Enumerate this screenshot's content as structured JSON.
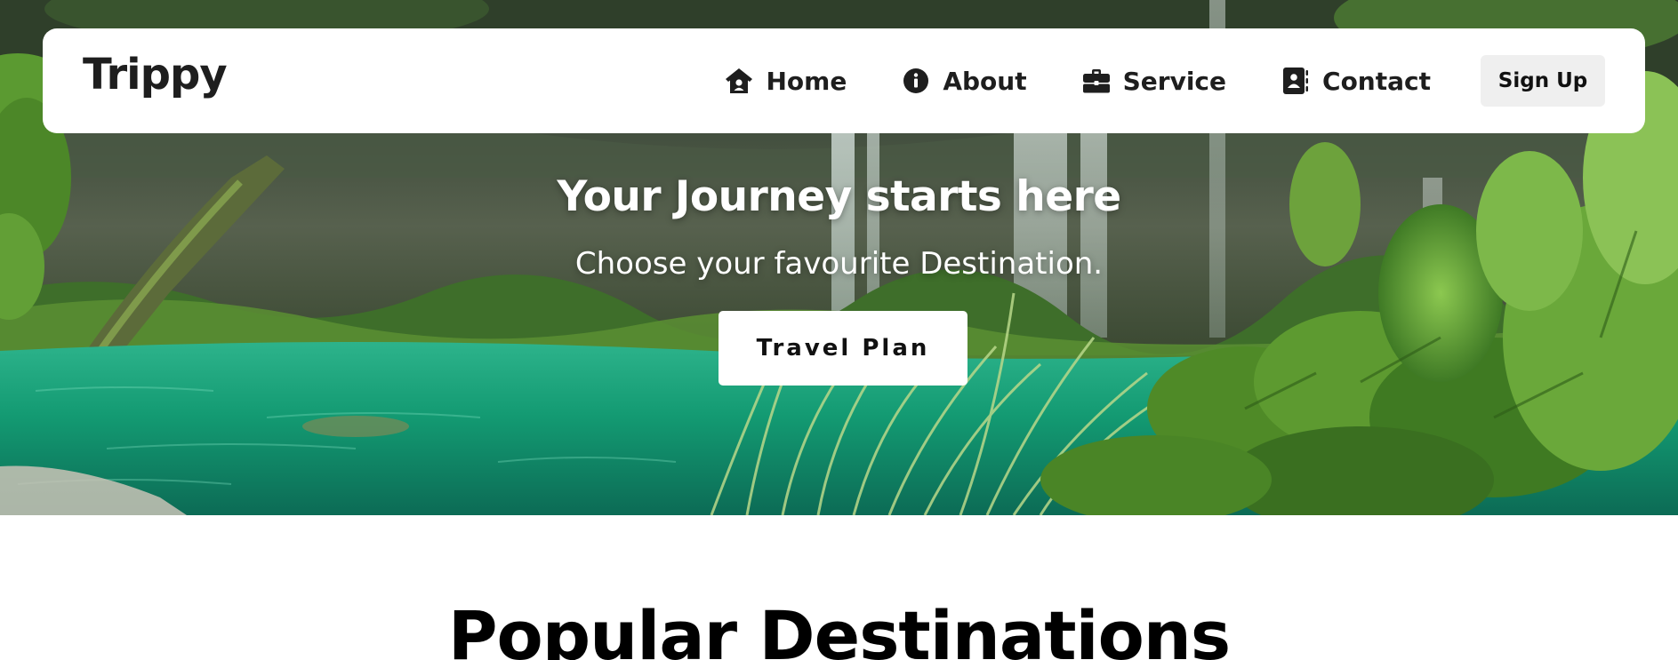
{
  "navbar": {
    "brand": "Trippy",
    "links": [
      {
        "label": "Home",
        "icon": "home-icon"
      },
      {
        "label": "About",
        "icon": "info-icon"
      },
      {
        "label": "Service",
        "icon": "briefcase-icon"
      },
      {
        "label": "Contact",
        "icon": "contact-book-icon"
      }
    ],
    "signup_label": "Sign Up"
  },
  "hero": {
    "title": "Your Journey starts here",
    "subtitle": "Choose your favourite Destination.",
    "cta_label": "Travel Plan",
    "image": "waterfall-lagoon-forest"
  },
  "section": {
    "title": "Popular Destinations"
  },
  "colors": {
    "text_dark": "#1e1e1e",
    "navbar_bg": "#ffffff",
    "signup_bg": "#efefef",
    "lagoon": "#17a37c",
    "foliage": "#4d8a2f"
  }
}
